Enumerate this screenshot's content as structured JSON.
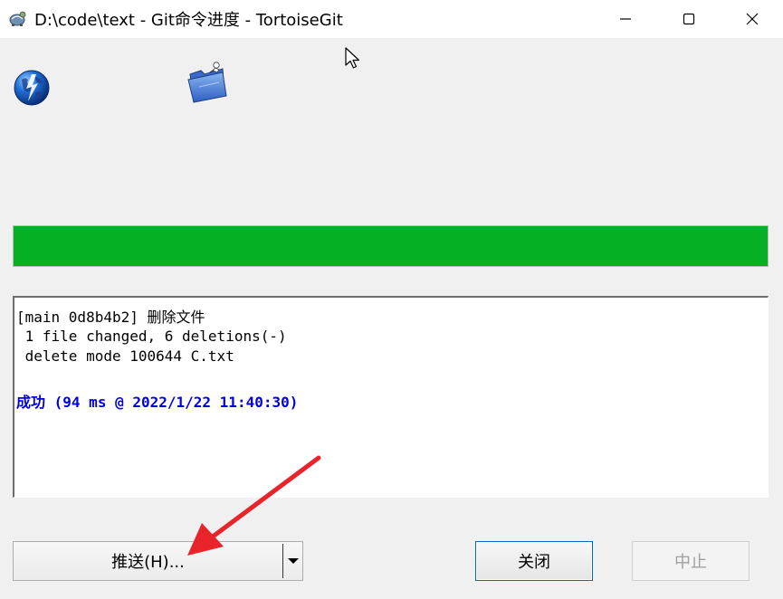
{
  "window": {
    "title": "D:\\code\\text - Git命令进度 - TortoiseGit",
    "icon": "tortoisegit-icon",
    "controls": {
      "minimize_icon": "minimize-icon",
      "maximize_icon": "maximize-icon",
      "close_icon": "close-icon"
    }
  },
  "icons": {
    "left": "globe-icon",
    "right": "folder-icon"
  },
  "progress": {
    "percent": 100,
    "color": "#06b025"
  },
  "log": {
    "lines": [
      {
        "prefix": "[main 0d8b4b2] ",
        "cjk": "删除文件"
      },
      {
        "text": " 1 file changed, 6 deletions(-)"
      },
      {
        "text": " delete mode 100644 C.txt"
      }
    ],
    "success": {
      "label": "成功",
      "detail": " (94 ms @ 2022/1/22 11:40:30)",
      "color": "#0000dd"
    }
  },
  "buttons": {
    "push_label": "推送(H)...",
    "close_label": "关闭",
    "abort_label": "中止"
  },
  "annotation": {
    "color": "#e8232a"
  }
}
